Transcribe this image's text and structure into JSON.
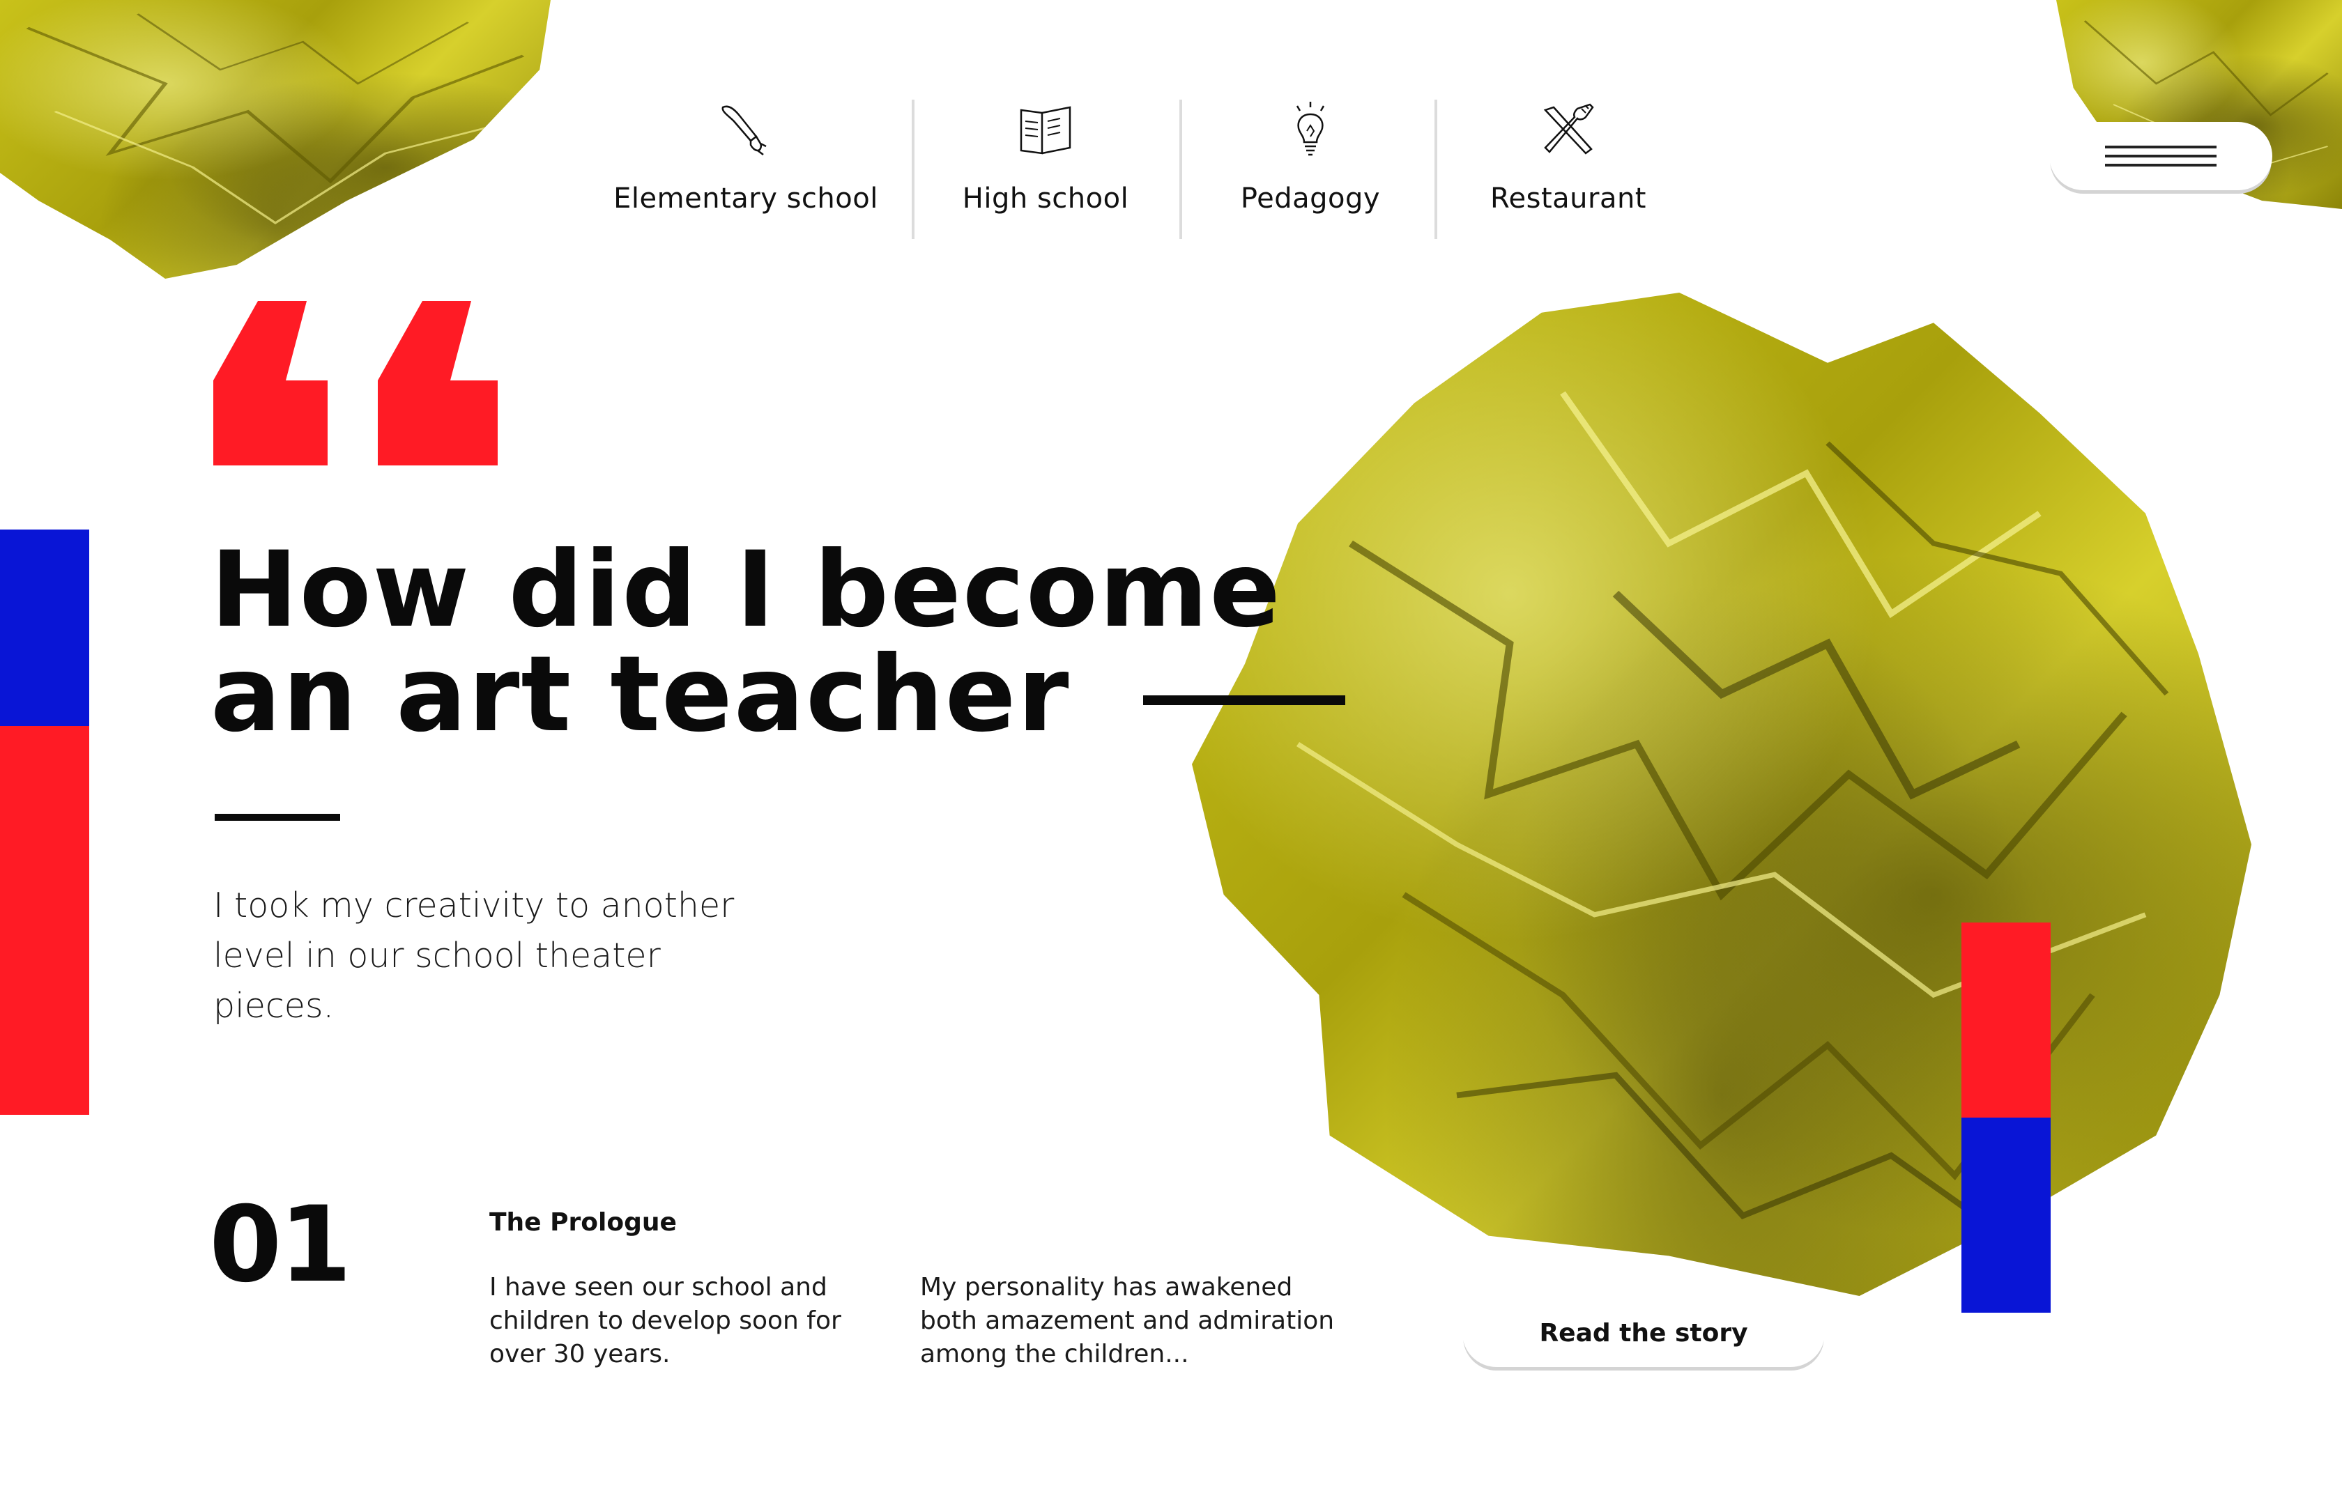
{
  "colors": {
    "accent_red": "#ff1b25",
    "accent_blue": "#0915d6",
    "paper_yellow": "#c2bb14",
    "text": "#0a0a0a"
  },
  "nav": {
    "items": [
      {
        "label": "Elementary school",
        "icon": "paintbrush-icon"
      },
      {
        "label": "High school",
        "icon": "open-book-icon"
      },
      {
        "label": "Pedagogy",
        "icon": "lightbulb-icon"
      },
      {
        "label": "Restaurant",
        "icon": "fork-knife-icon"
      }
    ]
  },
  "menu": {
    "icon": "hamburger-icon"
  },
  "hero": {
    "quote_icon": "quote-mark-icon",
    "headline_line1": "How did I become",
    "headline_line2": "an art teacher",
    "lead": "I took my creativity to another level in our school theater pieces."
  },
  "chapter": {
    "number": "01",
    "title": "The Prologue",
    "text_left": "I have seen our school and children to develop soon for over 30 years.",
    "text_right": "My personality has awakened both amazement and admiration among the children...",
    "cta_label": "Read the story"
  }
}
